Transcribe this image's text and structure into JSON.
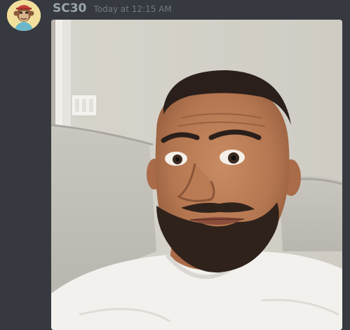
{
  "message": {
    "author": "SC30",
    "timestamp": "Today at 12:15 AM",
    "avatar_icon": "bored-ape-avatar-icon",
    "attachment_icon": "selfie-photo-icon"
  },
  "colors": {
    "background": "#36393f",
    "username": "#9aa6ad",
    "timestamp": "#727a82"
  }
}
